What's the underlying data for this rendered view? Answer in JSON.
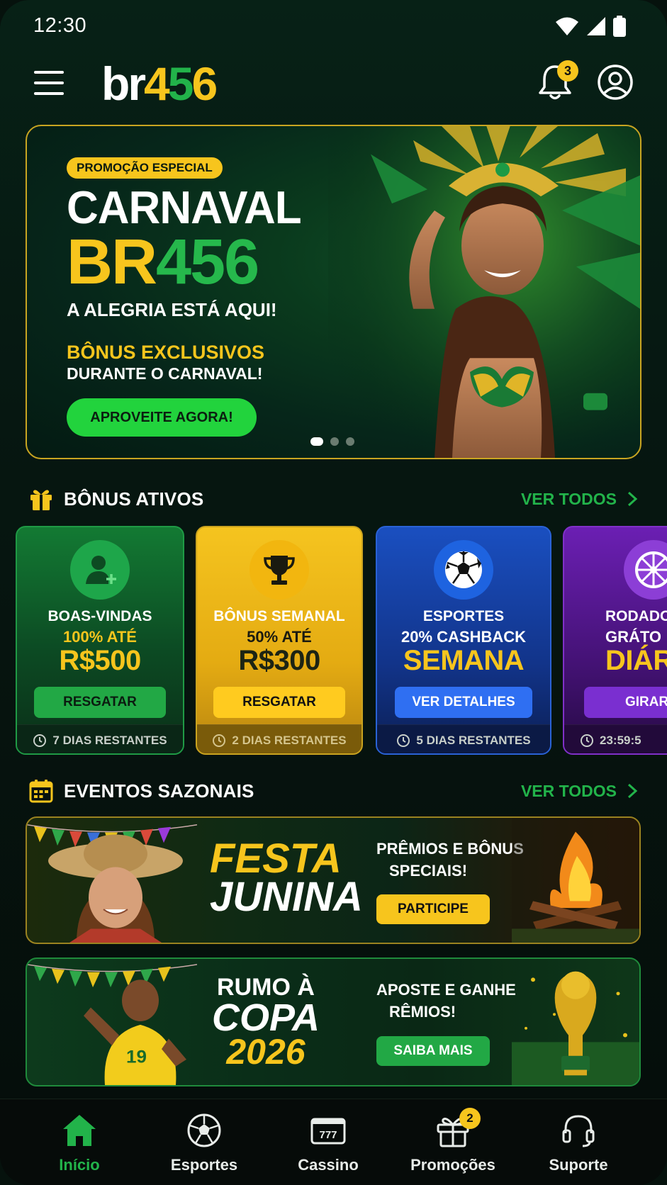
{
  "status_bar": {
    "time": "12:30"
  },
  "header": {
    "logo_part1": "br",
    "logo_part2": "4",
    "logo_part3": "5",
    "logo_part4": "6",
    "notification_count": "3"
  },
  "hero": {
    "tag": "PROMOÇÃO ESPECIAL",
    "title": "CARNAVAL",
    "title2_yellow": "BR",
    "title2_green": "456",
    "subtitle": "A ALEGRIA ESTÁ AQUI!",
    "bonus_line1": "BÔNUS EXCLUSIVOS",
    "bonus_line2": "DURANTE O CARNAVAL!",
    "cta": "APROVEITE AGORA!",
    "slides": 3,
    "active_slide": 1
  },
  "bonus_section": {
    "title": "BÔNUS ATIVOS",
    "see_all": "VER TODOS",
    "cards": [
      {
        "line1": "BOAS-VINDAS",
        "line2": "100% ATÉ",
        "line3": "R$500",
        "button": "RESGATAR",
        "footer": "7 DIAS RESTANTES",
        "icon": "user-plus-icon"
      },
      {
        "line1": "BÔNUS SEMANAL",
        "line2": "50% ATÉ",
        "line3": "R$300",
        "button": "RESGATAR",
        "footer": "2 DIAS RESTANTES",
        "icon": "trophy-icon"
      },
      {
        "line1": "ESPORTES",
        "line2": "20% CASHBACK",
        "line3": "SEMANA",
        "button": "VER DETALHES",
        "footer": "5 DIAS RESTANTES",
        "icon": "soccer-ball-icon"
      },
      {
        "line1": "RODADO",
        "line2": "GRÁTO",
        "line3": "DIÁR",
        "button": "GIRAR",
        "footer": "23:59:5",
        "icon": "wheel-icon"
      }
    ]
  },
  "events_section": {
    "title": "EVENTOS SAZONAIS",
    "see_all": "VER TODOS",
    "events": [
      {
        "title_line1": "FESTA",
        "title_line2": "JUNINA",
        "desc_line1": "PRÊMIOS E BÔNUS",
        "desc_line2": "SPECIAIS!",
        "button": "PARTICIPE"
      },
      {
        "title_line1": "RUMO À",
        "title_line2": "COPA",
        "title_line3": "2026",
        "desc_line1": "APOSTE E GANHE",
        "desc_line2": "RÊMIOS!",
        "button": "SAIBA MAIS"
      }
    ]
  },
  "bottom_nav": {
    "items": [
      {
        "label": "Início",
        "icon": "home-icon",
        "active": true
      },
      {
        "label": "Esportes",
        "icon": "soccer-ball-icon"
      },
      {
        "label": "Cassino",
        "icon": "slot-machine-icon"
      },
      {
        "label": "Promoções",
        "icon": "gift-icon",
        "badge": "2"
      },
      {
        "label": "Suporte",
        "icon": "headset-icon"
      }
    ]
  },
  "colors": {
    "brand_green": "#22b34a",
    "brand_yellow": "#f7c51d",
    "background": "#061711"
  }
}
